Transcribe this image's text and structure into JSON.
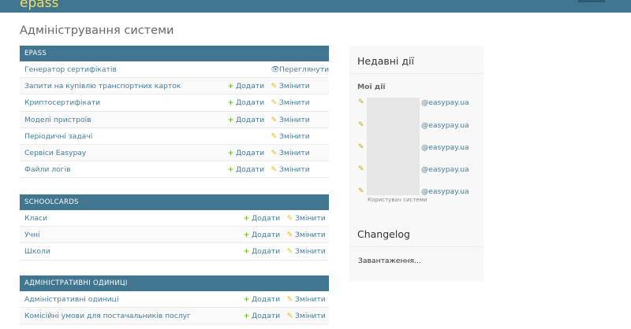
{
  "header": {
    "brand": "epass"
  },
  "page_title": "Адміністрування системи",
  "modules": [
    {
      "caption": "EPASS",
      "rows": [
        {
          "name": "Генератор сертифікатів",
          "view_label": "Переглянути"
        },
        {
          "name": "Запити на купівлю транспортних карток",
          "add_label": "Додати",
          "change_label": "Змінити"
        },
        {
          "name": "Криптосертифікати",
          "add_label": "Додати",
          "change_label": "Змінити"
        },
        {
          "name": "Моделі пристроїв",
          "add_label": "Додати",
          "change_label": "Змінити"
        },
        {
          "name": "Періодичні задачі",
          "change_label": "Змінити"
        },
        {
          "name": "Сервіси Easypay",
          "add_label": "Додати",
          "change_label": "Змінити"
        },
        {
          "name": "Файли логів",
          "add_label": "Додати",
          "change_label": "Змінити"
        }
      ]
    },
    {
      "caption": "SCHOOLCARDS",
      "rows": [
        {
          "name": "Класи",
          "add_label": "Додати",
          "change_label": "Змінити"
        },
        {
          "name": "Учні",
          "add_label": "Додати",
          "change_label": "Змінити"
        },
        {
          "name": "Школи",
          "add_label": "Додати",
          "change_label": "Змінити"
        }
      ]
    },
    {
      "caption": "АДМІНІСТРАТИВНІ ОДИНИЦІ",
      "rows": [
        {
          "name": "Адміністративні одиниці",
          "add_label": "Додати",
          "change_label": "Змінити"
        },
        {
          "name": "Комісійні умови для постачальників послуг",
          "add_label": "Додати",
          "change_label": "Змінити"
        }
      ]
    }
  ],
  "sidebar": {
    "recent_title": "Недавні дії",
    "my_actions_title": "Мої дії",
    "recent_actions": [
      {
        "email": "@easypay.ua"
      },
      {
        "email": "@easypay.ua"
      },
      {
        "email": "@easypay.ua"
      },
      {
        "email": "@easypay.ua"
      },
      {
        "email": "@easypay.ua"
      }
    ],
    "last_type": "Користувач системи",
    "changelog_title": "Changelog",
    "loading_text": "Завантаження..."
  },
  "icons": {
    "add": "plus-icon",
    "change": "pencil-icon",
    "view": "eye-icon"
  },
  "colors": {
    "header": "#417690",
    "brand": "#f5dd5d",
    "link": "#447e9b",
    "add": "#70bf2b",
    "change": "#efb80b"
  }
}
